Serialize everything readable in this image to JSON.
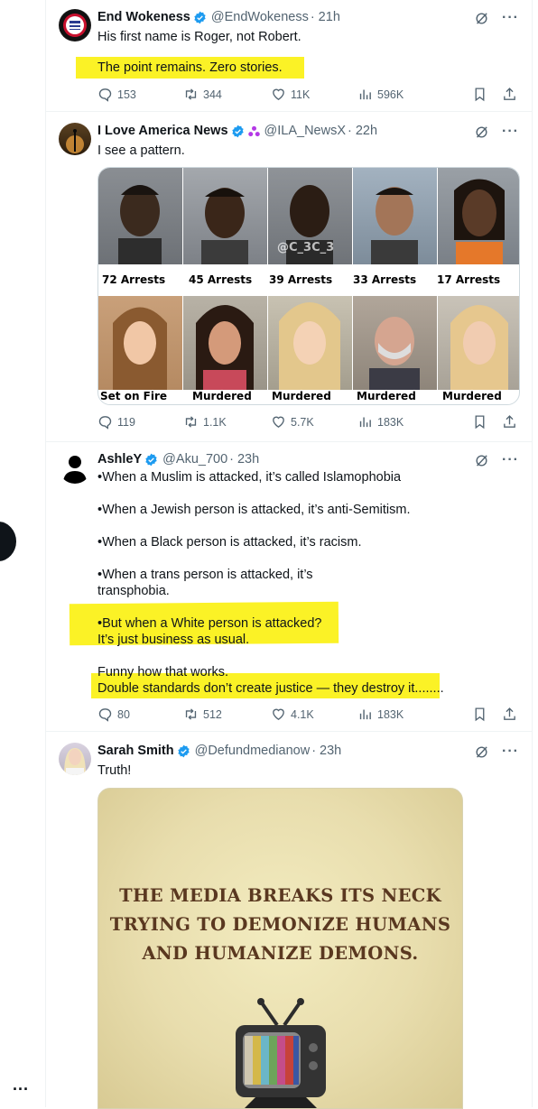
{
  "tweets": [
    {
      "name": "End Wokeness",
      "handle": "@EndWokeness",
      "time": "· 21h",
      "lines": [
        "His first name is Roger, not Robert."
      ],
      "highlight": "The point remains. Zero stories.",
      "replies": "153",
      "reposts": "344",
      "likes": "11K",
      "views": "596K"
    },
    {
      "name": "I Love America News",
      "handle": "@ILA_NewsX",
      "time": "· 22h",
      "lines": [
        "I see a pattern."
      ],
      "grid_top": [
        "72 Arrests",
        "45 Arrests",
        "39 Arrests",
        "33 Arrests",
        "17 Arrests"
      ],
      "grid_bottom": [
        "Set on Fire",
        "Murdered",
        "Murdered",
        "Murdered",
        "Murdered"
      ],
      "watermark": "@C_3C_3",
      "replies": "119",
      "reposts": "1.1K",
      "likes": "5.7K",
      "views": "183K"
    },
    {
      "name": "AshleY",
      "handle": "@Aku_700",
      "time": "· 23h",
      "p1": "•When a Muslim is attacked, it’s called Islamophobia",
      "p2": "•When a Jewish person is attacked, it’s anti-Semitism.",
      "p3": "•When a Black person is attacked, it’s racism.",
      "p4a": "•When a trans person is attacked, it’s",
      "p4b": "transphobia.",
      "h1": "•But when a White person is attacked?",
      "h2": "It’s just business as usual.",
      "h3": "Funny how that works.",
      "h4": "Double standards don’t create justice — they destroy it........",
      "replies": "80",
      "reposts": "512",
      "likes": "4.1K",
      "views": "183K"
    },
    {
      "name": "Sarah Smith",
      "handle": "@Defundmedianow",
      "time": "· 23h",
      "lines": [
        "Truth!"
      ],
      "poster_lines": [
        "THE MEDIA BREAKS ITS NECK",
        "TRYING TO DEMONIZE HUMANS",
        "AND HUMANIZE DEMONS."
      ]
    }
  ],
  "sidebar_more": "...",
  "colors": {
    "verified": "#1d9bf0",
    "highlight": "#fbf226",
    "muted": "#536471"
  }
}
